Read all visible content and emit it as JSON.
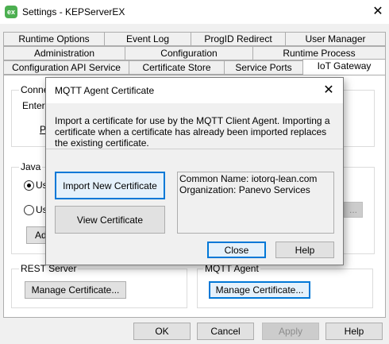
{
  "window": {
    "title": "Settings - KEPServerEX",
    "close_glyph": "✕",
    "icon_text": "ex"
  },
  "tabs": {
    "row1": [
      "Runtime Options",
      "Event Log",
      "ProgID Redirect",
      "User Manager"
    ],
    "row2": [
      "Administration",
      "Configuration",
      "Runtime Process"
    ],
    "row3": [
      "Configuration API Service",
      "Certificate Store",
      "Service Ports",
      "IoT Gateway"
    ],
    "active": "IoT Gateway"
  },
  "panel": {
    "conn_group_label": "Conne",
    "conn_enter_text": "Enter",
    "conn_p_text": "P",
    "java_group_label": "Java",
    "radio1_label": "Us",
    "radio2_label": "Us",
    "add_button": "Ad",
    "browse_button": "...",
    "rest_group_label": "REST Server",
    "rest_button": "Manage Certificate...",
    "mqtt_group_label": "MQTT Agent",
    "mqtt_button": "Manage Certificate..."
  },
  "footer": {
    "ok": "OK",
    "cancel": "Cancel",
    "apply": "Apply",
    "help": "Help"
  },
  "dialog": {
    "title": "MQTT Agent Certificate",
    "close_glyph": "✕",
    "description": "Import a certificate for use by the MQTT Client Agent. Importing a certificate when a certificate has already been imported replaces the existing certificate.",
    "import_button": "Import New Certificate",
    "view_button": "View Certificate",
    "common_name": "Common Name: iotorq-lean.com",
    "organization": "Organization: Panevo Services",
    "close_button": "Close",
    "help_button": "Help"
  }
}
